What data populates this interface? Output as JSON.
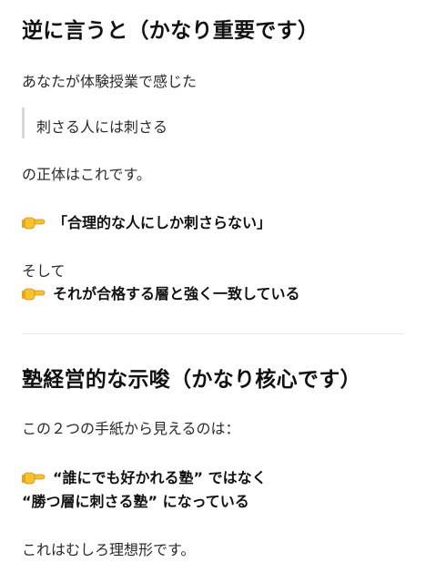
{
  "section1": {
    "heading": "逆に言うと（かなり重要です）",
    "intro": "あなたが体験授業で感じた",
    "quote": "刺さる人には刺さる",
    "body": "の正体はこれです。",
    "point1": "「合理的な人にしか刺さらない」",
    "connector": "そして",
    "point2": "それが合格する層と強く一致している"
  },
  "section2": {
    "heading": "塾経営的な示唆（かなり核心です）",
    "intro": "この２つの手紙から見えるのは：",
    "point_line1": "“誰にでも好かれる塾” ではなく",
    "point_line2": "“勝つ層に刺さる塾” になっている",
    "conclusion": "これはむしろ理想形です。"
  },
  "icons": {
    "pointer": "backhand-index-pointing-right-icon"
  },
  "colors": {
    "text": "#1f1f1f",
    "quote_bar": "#d8d8d8",
    "divider": "#e6e6e6",
    "emoji_yellow": "#f7c22e"
  }
}
